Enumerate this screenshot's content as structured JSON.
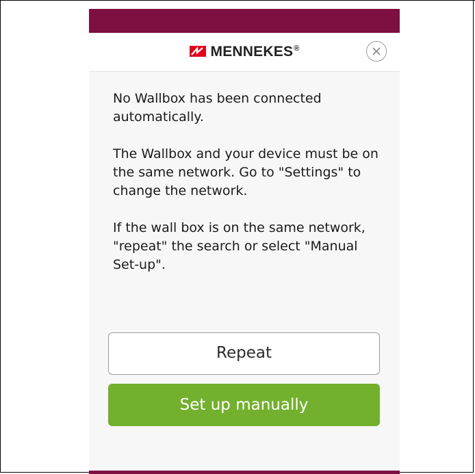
{
  "app": {
    "brand_name": "MENNEKES",
    "brand_mark": "®",
    "brand_color": "#e2001a",
    "accent_color": "#7d1040"
  },
  "header": {
    "close_icon": "close-circle-icon"
  },
  "message": {
    "paragraph_1": "No Wallbox has been connected automatically.",
    "paragraph_2": "The Wallbox and your device must be on the same network. Go to \"Settings\" to change the network.",
    "paragraph_3": "If the wall box is on the same network, \"repeat\" the search or select \"Manual Set-up\"."
  },
  "actions": {
    "repeat_label": "Repeat",
    "manual_label": "Set up manually",
    "manual_color": "#72b02e"
  }
}
